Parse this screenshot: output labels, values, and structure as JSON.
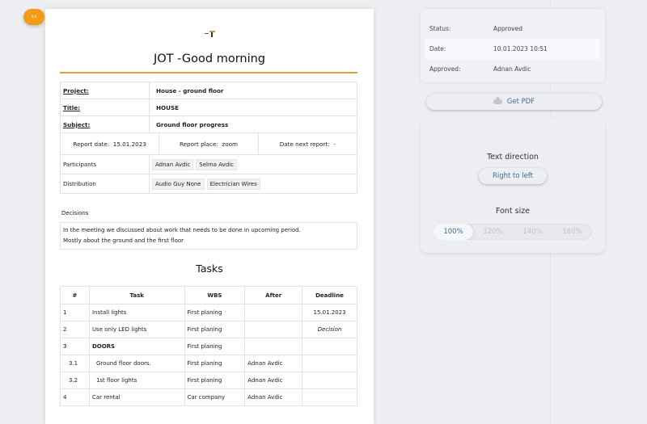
{
  "nav": {
    "back_label": "‹‹"
  },
  "doc": {
    "title": "JOT -Good morning",
    "project_label": "Project:",
    "project_value": "House - ground floor",
    "title_label": "Title:",
    "title_value": "HOUSE",
    "subject_label": "Subject:",
    "subject_value": "Ground floor progress",
    "report_date_label": "Report date:",
    "report_date_value": "15.01.2023",
    "report_place_label": "Report place:",
    "report_place_value": "zoom",
    "next_report_label": "Date next report:",
    "next_report_value": "-",
    "participants_label": "Participants",
    "participants": [
      "Adnan Avdic",
      "Selma Avdic"
    ],
    "distribution_label": "Distribution",
    "distribution": [
      "Audio Guy None",
      "Electrician Wires"
    ],
    "decisions_label": "Decisions",
    "decisions_line1": "In the meeting we discussed about work that needs to be done in upcoming period.",
    "decisions_line2": "Mostly about the ground and the first floor"
  },
  "tasks": {
    "title": "Tasks",
    "headers": [
      "#",
      "Task",
      "WBS",
      "After",
      "Deadline"
    ],
    "rows": [
      [
        "1",
        "Install lights",
        "First planing",
        "",
        "15.01.2023"
      ],
      [
        "2",
        "Use only LED lights",
        "First planing",
        "",
        "Decision"
      ],
      [
        "3",
        "DOORS",
        "First planing",
        "",
        ""
      ],
      [
        "3.1",
        "Ground floor doors.",
        "First planing",
        "Adnan Avdic",
        ""
      ],
      [
        "3.2",
        "1st floor lights",
        "First planing",
        "Adnan Avdic",
        ""
      ],
      [
        "4",
        "Car rental",
        "Car company",
        "Adnan Avdic",
        ""
      ]
    ]
  },
  "status": {
    "status_label": "Status:",
    "status_value": "Approved",
    "date_label": "Date:",
    "date_value": "10.01.2023 10:51",
    "approved_label": "Approved:",
    "approved_value": "Adnan Avdic"
  },
  "actions": {
    "get_pdf": "Get PDF",
    "get_pdf_icon": "cloud-icon"
  },
  "settings": {
    "text_direction_label": "Text direction",
    "rtl_button": "Right to left",
    "font_size_label": "Font size",
    "font_sizes": [
      "100%",
      "120%",
      "140%",
      "160%"
    ],
    "selected_font_size": "100%"
  },
  "colors": {
    "accent_orange": "#f39a18",
    "title_rule": "#d9a437",
    "link_blue": "#3d6e8c"
  }
}
